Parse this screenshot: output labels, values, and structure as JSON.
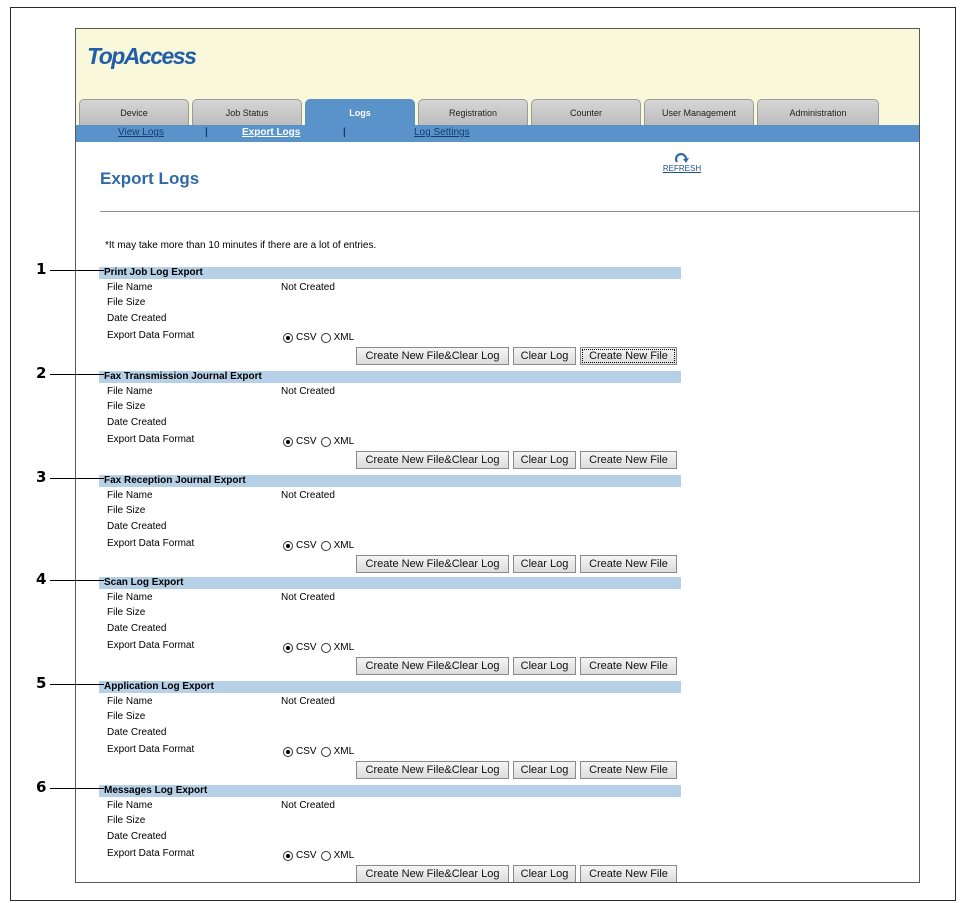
{
  "app": {
    "logo_text": "TopAccess"
  },
  "tabs": [
    {
      "label": "Device"
    },
    {
      "label": "Job Status"
    },
    {
      "label": "Logs",
      "active": true
    },
    {
      "label": "Registration"
    },
    {
      "label": "Counter"
    },
    {
      "label": "User Management"
    },
    {
      "label": "Administration"
    }
  ],
  "subnav": {
    "items": [
      {
        "label": "View Logs",
        "current": false
      },
      {
        "label": "Export Logs",
        "current": true
      },
      {
        "label": "Log Settings",
        "current": false
      }
    ],
    "separator": "|"
  },
  "page": {
    "title": "Export Logs",
    "refresh_label": "REFRESH"
  },
  "note": "*It may take more than 10 minutes if there are a lot of entries.",
  "fields": {
    "file_name": "File Name",
    "file_size": "File Size",
    "date_created": "Date Created",
    "export_data_format": "Export Data Format"
  },
  "format_options": [
    "CSV",
    "XML"
  ],
  "buttons": {
    "create_clear": "Create New File&Clear Log",
    "clear": "Clear Log",
    "create": "Create New File"
  },
  "sections": [
    {
      "callout": "1",
      "title": "Print Job Log Export",
      "file_name": "Not Created",
      "file_size": "",
      "date_created": "",
      "format": "CSV"
    },
    {
      "callout": "2",
      "title": "Fax Transmission Journal Export",
      "file_name": "Not Created",
      "file_size": "",
      "date_created": "",
      "format": "CSV"
    },
    {
      "callout": "3",
      "title": "Fax Reception Journal Export",
      "file_name": "Not Created",
      "file_size": "",
      "date_created": "",
      "format": "CSV"
    },
    {
      "callout": "4",
      "title": "Scan Log Export",
      "file_name": "Not Created",
      "file_size": "",
      "date_created": "",
      "format": "CSV"
    },
    {
      "callout": "5",
      "title": "Application Log Export",
      "file_name": "Not Created",
      "file_size": "",
      "date_created": "",
      "format": "CSV"
    },
    {
      "callout": "6",
      "title": "Messages Log Export",
      "file_name": "Not Created",
      "file_size": "",
      "date_created": "",
      "format": "CSV"
    }
  ],
  "colors": {
    "header_bg": "#f9f8da",
    "tab_active": "#5a93c9",
    "section_header": "#b6d1e7",
    "title_blue": "#2f6aa6"
  }
}
